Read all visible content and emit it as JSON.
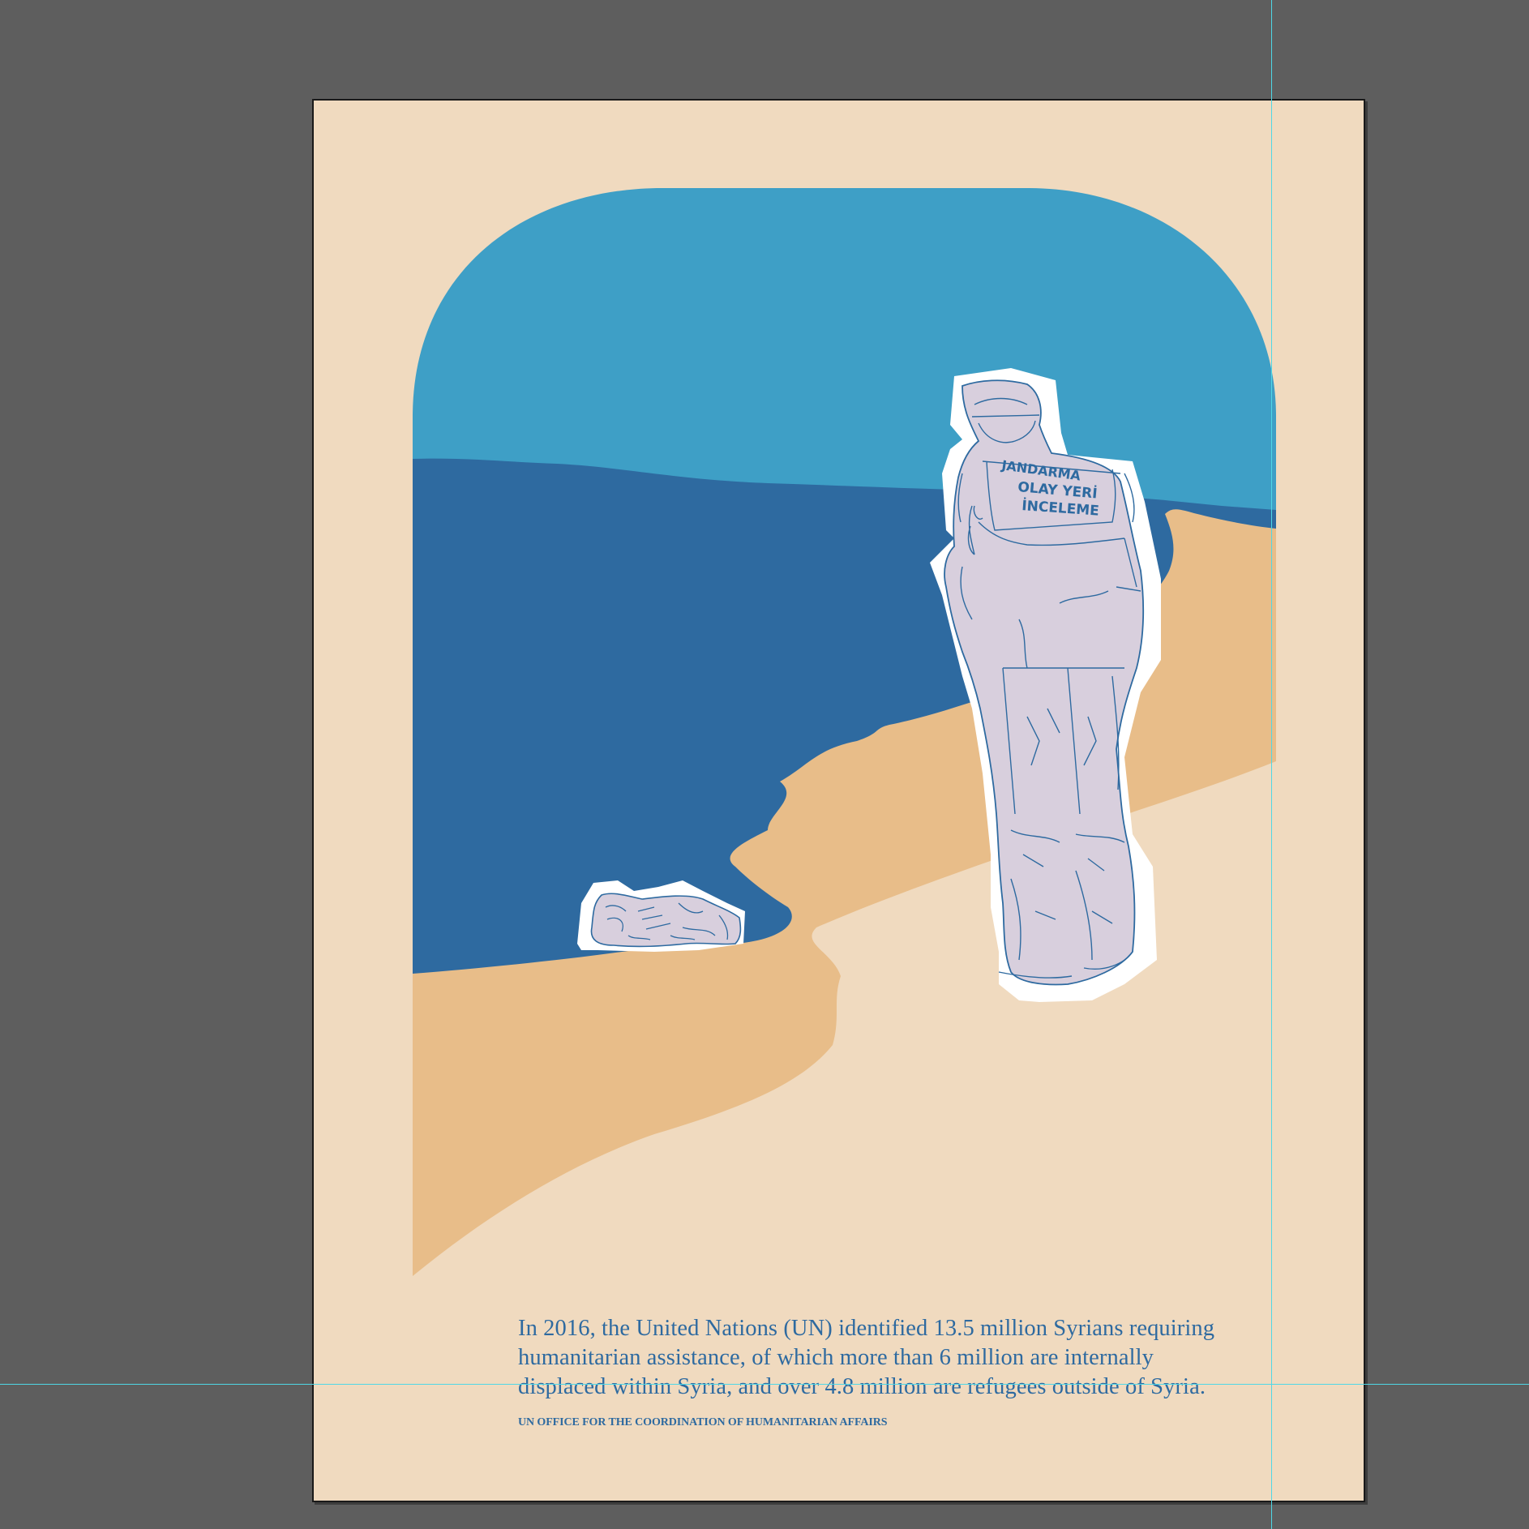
{
  "document": {
    "quote": {
      "line1": "In 2016, the United Nations (UN) identified 13.5 million Syrians requiring",
      "line2": "humanitarian assistance, of which more than 6 million are internally",
      "line3": "displaced within Syria, and over 4.8 million are refugees outside of Syria."
    },
    "source": "UN OFFICE FOR THE COORDINATION OF HUMANITARIAN AFFAIRS",
    "figure_jacket_text": {
      "top": "JANDARMA",
      "middle": "OLAY YERİ",
      "bottom": "İNCELEME"
    }
  },
  "colors": {
    "pasteboard": "#5e5e5e",
    "paper": "#f0dabf",
    "sky": "#3e9fc6",
    "sea": "#2e6aa0",
    "sand": "#e8bd89",
    "figure_fill": "#d8cfdd",
    "outline": "#2e6aa0",
    "guides": "#4fd7e6"
  },
  "icons": {
    "standing_figure": "officer-figure-icon",
    "lying_figure": "child-figure-icon"
  }
}
